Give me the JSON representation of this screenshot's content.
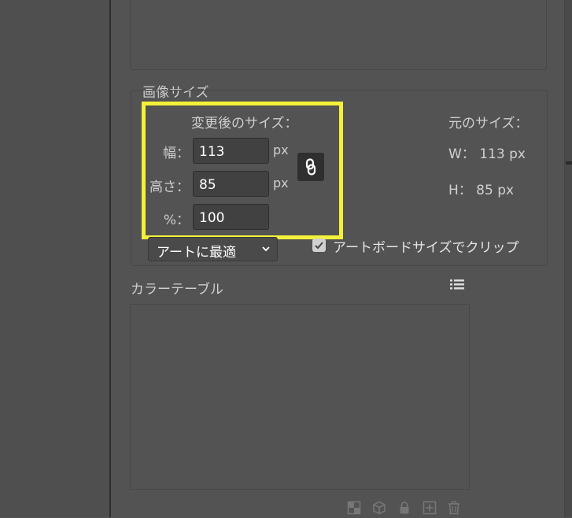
{
  "image_size": {
    "title": "画像サイズ",
    "new_size_label": "変更後のサイズ：",
    "width_label": "幅：",
    "height_label": "高さ：",
    "percent_label": "%：",
    "width_value": "113",
    "height_value": "85",
    "percent_value": "100",
    "unit": "px",
    "original_label": "元のサイズ：",
    "original_w": "W： 113 px",
    "original_h": "H：  85 px",
    "fit_option": "アートに最適",
    "clip_label": "アートボードサイズでクリップ",
    "clip_checked": true
  },
  "color_table": {
    "title": "カラーテーブル"
  },
  "bottom_toolbar": {
    "icons": [
      "transparency-map-icon",
      "cube-icon",
      "lock-icon",
      "add-icon",
      "trash-icon"
    ]
  },
  "colors": {
    "highlight": "#f4f13a",
    "panel_bg": "#535353"
  }
}
